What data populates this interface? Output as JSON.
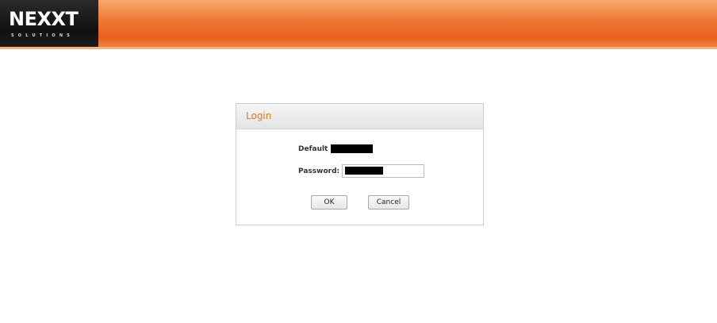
{
  "header": {
    "logo_text": "NEXXT",
    "logo_subtext": "SOLUTIONS"
  },
  "login": {
    "title": "Login",
    "default_label": "Default",
    "password_label": "Password:",
    "ok_label": "OK",
    "cancel_label": "Cancel"
  },
  "colors": {
    "brand_orange": "#e8601f",
    "title_orange": "#e07a1f"
  }
}
